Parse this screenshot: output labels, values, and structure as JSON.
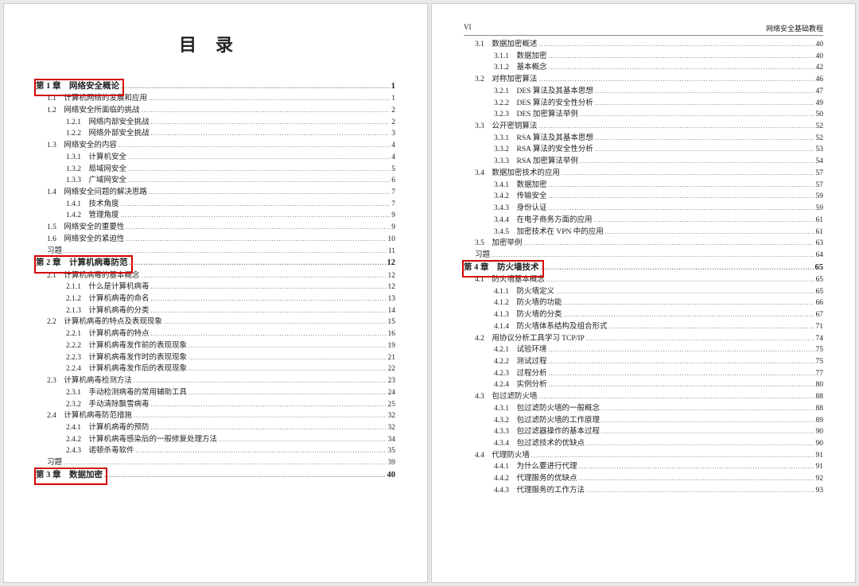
{
  "header": {
    "roman": "VI",
    "book_title": "网络安全基础教程"
  },
  "big_title": "目录",
  "left_lines": [
    {
      "level": 0,
      "label": "第 1 章　网络安全概论",
      "page": "1"
    },
    {
      "level": 1,
      "label": "1.1　计算机网络的发展和应用",
      "page": "1"
    },
    {
      "level": 1,
      "label": "1.2　网络安全所面临的挑战",
      "page": "2"
    },
    {
      "level": 2,
      "label": "1.2.1　网络内部安全挑战",
      "page": "2"
    },
    {
      "level": 2,
      "label": "1.2.2　网络外部安全挑战",
      "page": "3"
    },
    {
      "level": 1,
      "label": "1.3　网络安全的内容",
      "page": "4"
    },
    {
      "level": 2,
      "label": "1.3.1　计算机安全",
      "page": "4"
    },
    {
      "level": 2,
      "label": "1.3.2　局域网安全",
      "page": "5"
    },
    {
      "level": 2,
      "label": "1.3.3　广域网安全",
      "page": "6"
    },
    {
      "level": 1,
      "label": "1.4　网络安全问题的解决思路",
      "page": "7"
    },
    {
      "level": 2,
      "label": "1.4.1　技术角度",
      "page": "7"
    },
    {
      "level": 2,
      "label": "1.4.2　管理角度",
      "page": "9"
    },
    {
      "level": 1,
      "label": "1.5　网络安全的重要性",
      "page": "9"
    },
    {
      "level": 1,
      "label": "1.6　网络安全的紧迫性",
      "page": "10"
    },
    {
      "level": 1,
      "label": "习题",
      "page": "11"
    },
    {
      "level": 0,
      "label": "第 2 章　计算机病毒防范",
      "page": "12"
    },
    {
      "level": 1,
      "label": "2.1　计算机病毒的基本概念",
      "page": "12"
    },
    {
      "level": 2,
      "label": "2.1.1　什么是计算机病毒",
      "page": "12"
    },
    {
      "level": 2,
      "label": "2.1.2　计算机病毒的命名",
      "page": "13"
    },
    {
      "level": 2,
      "label": "2.1.3　计算机病毒的分类",
      "page": "14"
    },
    {
      "level": 1,
      "label": "2.2　计算机病毒的特点及表现现象",
      "page": "15"
    },
    {
      "level": 2,
      "label": "2.2.1　计算机病毒的特点",
      "page": "16"
    },
    {
      "level": 2,
      "label": "2.2.2　计算机病毒发作前的表现现象",
      "page": "19"
    },
    {
      "level": 2,
      "label": "2.2.3　计算机病毒发作时的表现现象",
      "page": "21"
    },
    {
      "level": 2,
      "label": "2.2.4　计算机病毒发作后的表现现象",
      "page": "22"
    },
    {
      "level": 1,
      "label": "2.3　计算机病毒检测方法",
      "page": "23"
    },
    {
      "level": 2,
      "label": "2.3.1　手动检测病毒的常用辅助工具",
      "page": "24"
    },
    {
      "level": 2,
      "label": "2.3.2　手动清除飘雪病毒",
      "page": "25"
    },
    {
      "level": 1,
      "label": "2.4　计算机病毒防范措施",
      "page": "32"
    },
    {
      "level": 2,
      "label": "2.4.1　计算机病毒的预防",
      "page": "32"
    },
    {
      "level": 2,
      "label": "2.4.2　计算机病毒感染后的一般修复处理方法",
      "page": "34"
    },
    {
      "level": 2,
      "label": "2.4.3　诺顿杀毒软件",
      "page": "35"
    },
    {
      "level": 1,
      "label": "习题",
      "page": "39"
    },
    {
      "level": 0,
      "label": "第 3 章　数据加密",
      "page": "40"
    }
  ],
  "right_lines": [
    {
      "level": 1,
      "label": "3.1　数据加密概述",
      "page": "40"
    },
    {
      "level": 2,
      "label": "3.1.1　数据加密",
      "page": "40"
    },
    {
      "level": 2,
      "label": "3.1.2　基本概念",
      "page": "42"
    },
    {
      "level": 1,
      "label": "3.2　对称加密算法",
      "page": "46"
    },
    {
      "level": 2,
      "label": "3.2.1　DES 算法及其基本思想",
      "page": "47"
    },
    {
      "level": 2,
      "label": "3.2.2　DES 算法的安全性分析",
      "page": "49"
    },
    {
      "level": 2,
      "label": "3.2.3　DES 加密算法举例",
      "page": "50"
    },
    {
      "level": 1,
      "label": "3.3　公开密钥算法",
      "page": "52"
    },
    {
      "level": 2,
      "label": "3.3.1　RSA 算法及其基本思想",
      "page": "52"
    },
    {
      "level": 2,
      "label": "3.3.2　RSA 算法的安全性分析",
      "page": "53"
    },
    {
      "level": 2,
      "label": "3.3.3　RSA 加密算法举例",
      "page": "54"
    },
    {
      "level": 1,
      "label": "3.4　数据加密技术的应用",
      "page": "57"
    },
    {
      "level": 2,
      "label": "3.4.1　数据加密",
      "page": "57"
    },
    {
      "level": 2,
      "label": "3.4.2　传输安全",
      "page": "59"
    },
    {
      "level": 2,
      "label": "3.4.3　身份认证",
      "page": "59"
    },
    {
      "level": 2,
      "label": "3.4.4　在电子商务方面的应用",
      "page": "61"
    },
    {
      "level": 2,
      "label": "3.4.5　加密技术在 VPN 中的应用",
      "page": "61"
    },
    {
      "level": 1,
      "label": "3.5　加密举例",
      "page": "63"
    },
    {
      "level": 1,
      "label": "习题",
      "page": "64"
    },
    {
      "level": 0,
      "label": "第 4 章　防火墙技术",
      "page": "65"
    },
    {
      "level": 1,
      "label": "4.1　防火墙基本概念",
      "page": "65"
    },
    {
      "level": 2,
      "label": "4.1.1　防火墙定义",
      "page": "65"
    },
    {
      "level": 2,
      "label": "4.1.2　防火墙的功能",
      "page": "66"
    },
    {
      "level": 2,
      "label": "4.1.3　防火墙的分类",
      "page": "67"
    },
    {
      "level": 2,
      "label": "4.1.4　防火墙体系结构及组合形式",
      "page": "71"
    },
    {
      "level": 1,
      "label": "4.2　用协议分析工具学习 TCP/IP",
      "page": "74"
    },
    {
      "level": 2,
      "label": "4.2.1　试验环境",
      "page": "75"
    },
    {
      "level": 2,
      "label": "4.2.2　测试过程",
      "page": "75"
    },
    {
      "level": 2,
      "label": "4.2.3　过程分析",
      "page": "77"
    },
    {
      "level": 2,
      "label": "4.2.4　实例分析",
      "page": "80"
    },
    {
      "level": 1,
      "label": "4.3　包过滤防火墙",
      "page": "88"
    },
    {
      "level": 2,
      "label": "4.3.1　包过滤防火墙的一般概念",
      "page": "88"
    },
    {
      "level": 2,
      "label": "4.3.2　包过滤防火墙的工作原理",
      "page": "89"
    },
    {
      "level": 2,
      "label": "4.3.3　包过滤器操作的基本过程",
      "page": "90"
    },
    {
      "level": 2,
      "label": "4.3.4　包过滤技术的优缺点",
      "page": "90"
    },
    {
      "level": 1,
      "label": "4.4　代理防火墙",
      "page": "91"
    },
    {
      "level": 2,
      "label": "4.4.1　为什么要进行代理",
      "page": "91"
    },
    {
      "level": 2,
      "label": "4.4.2　代理服务的优缺点",
      "page": "92"
    },
    {
      "level": 2,
      "label": "4.4.3　代理服务的工作方法",
      "page": "93"
    }
  ],
  "highlights_left": [
    {
      "top_line": 0
    },
    {
      "top_line": 15
    },
    {
      "top_line": 33
    }
  ],
  "highlights_right": [
    {
      "top_line": 19
    }
  ]
}
